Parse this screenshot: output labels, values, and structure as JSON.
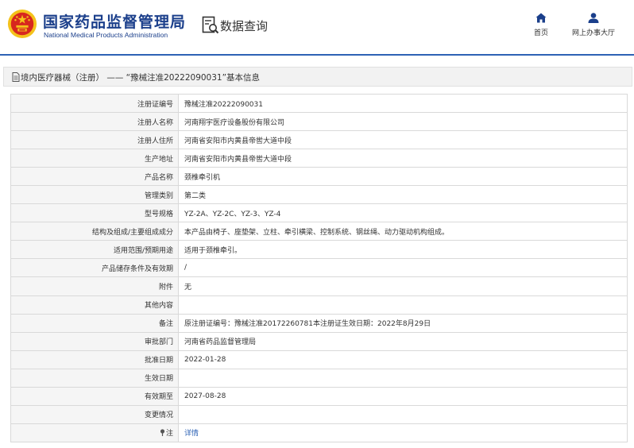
{
  "header": {
    "agency_cn": "国家药品监督管理局",
    "agency_en": "National Medical Products Administration",
    "section_label": "数据查询",
    "nav": [
      {
        "label": "首页",
        "icon": "home-icon"
      },
      {
        "label": "网上办事大厅",
        "icon": "user-icon"
      }
    ]
  },
  "title_bar": {
    "text": "境内医疗器械（注册） —— “豫械注准20222090031”基本信息",
    "icon": "document-icon"
  },
  "detail": {
    "rows": [
      {
        "key": "注册证编号",
        "value": "豫械注准20222090031"
      },
      {
        "key": "注册人名称",
        "value": "河南翔宇医疗设备股份有限公司"
      },
      {
        "key": "注册人住所",
        "value": "河南省安阳市内黄县帝喾大道中段"
      },
      {
        "key": "生产地址",
        "value": "河南省安阳市内黄县帝喾大道中段"
      },
      {
        "key": "产品名称",
        "value": "颈椎牵引机"
      },
      {
        "key": "管理类别",
        "value": "第二类"
      },
      {
        "key": "型号规格",
        "value": "YZ-2A、YZ-2C、YZ-3、YZ-4"
      },
      {
        "key": "结构及组成/主要组成成分",
        "value": "本产品由椅子、座垫架、立柱、牵引横梁、控制系统、钢丝绳、动力驱动机构组成。"
      },
      {
        "key": "适用范围/预期用途",
        "value": "适用于颈椎牵引。"
      },
      {
        "key": "产品储存条件及有效期",
        "value": "/"
      },
      {
        "key": "附件",
        "value": "无"
      },
      {
        "key": "其他内容",
        "value": ""
      },
      {
        "key": "备注",
        "value": "原注册证编号：豫械注准20172260781本注册证生效日期：2022年8月29日"
      },
      {
        "key": "审批部门",
        "value": "河南省药品监督管理局"
      },
      {
        "key": "批准日期",
        "value": "2022-01-28"
      },
      {
        "key": "生效日期",
        "value": ""
      },
      {
        "key": "有效期至",
        "value": "2027-08-28"
      },
      {
        "key": "变更情况",
        "value": ""
      },
      {
        "key": "注",
        "value": "详情",
        "icon": "pin-icon"
      }
    ]
  },
  "colors": {
    "brand_blue": "#1b3f8b",
    "accent_blue": "#2d62b5",
    "emblem_red": "#d7261e",
    "emblem_gold": "#f4c21b"
  }
}
